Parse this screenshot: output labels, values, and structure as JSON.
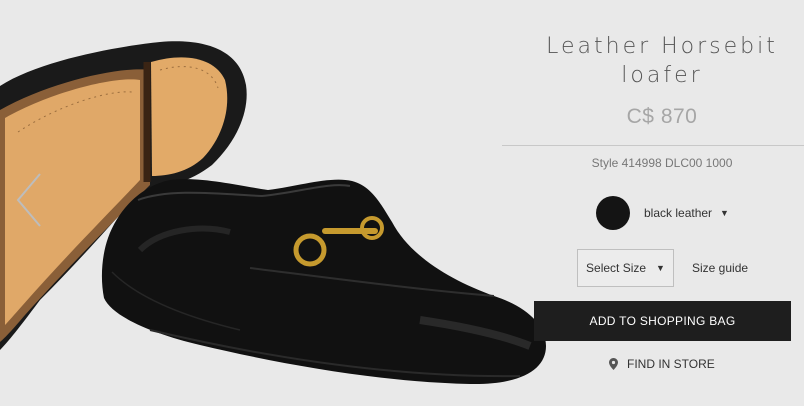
{
  "product": {
    "title_line1": "Leather Horsebit",
    "title_line2": "loafer",
    "price": "C$ 870",
    "style_code": "Style 414998 DLC00 1000"
  },
  "color": {
    "label": "black leather",
    "swatch": "#141414",
    "icon": "chevron-down-icon"
  },
  "size": {
    "selected": "Select Size",
    "guide": "Size guide"
  },
  "actions": {
    "add_to_bag": "ADD TO SHOPPING BAG",
    "find_in_store": "FIND IN STORE",
    "find_icon": "location-pin-icon"
  },
  "gallery": {
    "prev_icon": "chevron-left-icon"
  },
  "colors": {
    "background": "#e9e9e9",
    "button": "#1e1e1e",
    "price": "#a6a6a6"
  }
}
